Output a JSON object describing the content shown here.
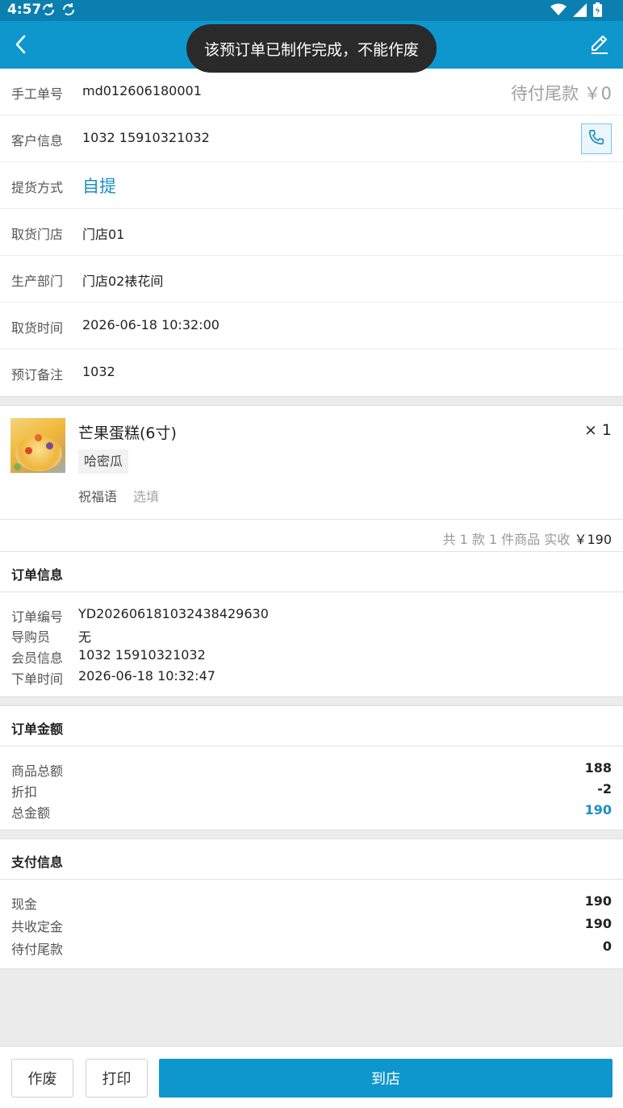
{
  "status_bar": {
    "time": "4:57",
    "sync_icons": [
      "sync-icon",
      "sync-icon"
    ],
    "system_icons": [
      "wifi-icon",
      "signal-icon",
      "battery-icon"
    ]
  },
  "toast": {
    "message": "该预订单已制作完成，不能作废"
  },
  "colors": {
    "primary": "#0e97cd",
    "status_bar": "#0a7fb0",
    "accent_text": "#1b8fc4",
    "toast_bg": "#2a2a2a"
  },
  "header": {
    "manual_no_label": "手工单号",
    "manual_no": "md012606180001",
    "balance_due": "待付尾款 ￥0",
    "customer_label": "客户信息",
    "customer": "1032 15910321032",
    "pickup_method_label": "提货方式",
    "pickup_method": "自提",
    "pickup_store_label": "取货门店",
    "pickup_store": "门店01",
    "production_dept_label": "生产部门",
    "production_dept": "门店02裱花间",
    "pickup_time_label": "取货时间",
    "pickup_time": "2026-06-18 10:32:00",
    "remark_label": "预订备注",
    "remark": "1032"
  },
  "product": {
    "name": "芒果蛋糕(6寸)",
    "quantity": "× 1",
    "tag": "哈密瓜",
    "blessing_label": "祝福语",
    "blessing_placeholder": "选填"
  },
  "summary": {
    "prefix": "共 1 款 1 件商品 实收",
    "total": "￥190"
  },
  "order_info": {
    "title": "订单信息",
    "items": [
      {
        "label": "订单编号",
        "value": "YD202606181032438429630"
      },
      {
        "label": "导购员",
        "value": "无"
      },
      {
        "label": "会员信息",
        "value": "1032 15910321032"
      },
      {
        "label": "下单时间",
        "value": "2026-06-18 10:32:47"
      }
    ]
  },
  "order_amount": {
    "title": "订单金额",
    "items": [
      {
        "label": "商品总额",
        "value": "188"
      },
      {
        "label": "折扣",
        "value": "-2"
      },
      {
        "label": "总金额",
        "value": "190"
      }
    ]
  },
  "payment_info": {
    "title": "支付信息",
    "items": [
      {
        "label": "现金",
        "value": "190"
      },
      {
        "label": "共收定金",
        "value": "190"
      },
      {
        "label": "待付尾款",
        "value": "0"
      }
    ]
  },
  "bottom_bar": {
    "void_label": "作废",
    "print_label": "打印",
    "arrive_label": "到店"
  }
}
